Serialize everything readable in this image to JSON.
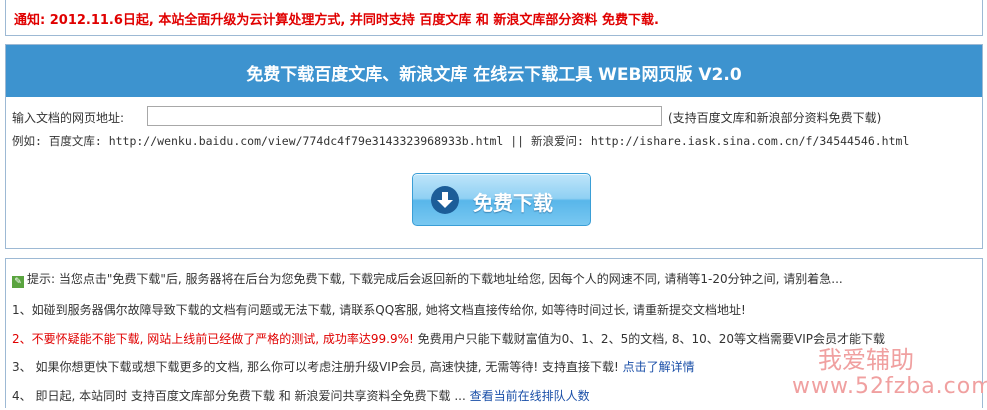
{
  "notice": {
    "text": "通知: 2012.11.6日起, 本站全面升级为云计算处理方式, 并同时支持 百度文库 和 新浪文库部分资料 免费下载."
  },
  "tool": {
    "title": "免费下载百度文库、新浪文库 在线云下载工具 WEB网页版 V2.0",
    "url_label": "输入文档的网页地址:",
    "url_value": "",
    "url_hint": "(支持百度文库和新浪部分资料免费下载)",
    "example": "例如: 百度文库: http://wenku.baidu.com/view/774dc4f79e3143323968933b.html || 新浪爱问: http://ishare.iask.sina.com.cn/f/34544546.html",
    "download_button": "免费下载"
  },
  "info": {
    "tip_icon": "bookmark-icon",
    "tip_text": "提示: 当您点击\"免费下载\"后, 服务器将在后台为您免费下载, 下载完成后会返回新的下载地址给您, 因每个人的网速不同, 请稍等1-20分钟之间, 请别着急...",
    "item1": "1、如碰到服务器偶尔故障导致下载的文档有问题或无法下载, 请联系QQ客服, 她将文档直接传给你, 如等待时间过长, 请重新提交文档地址!",
    "item2_prefix": "2、",
    "item2_red": "不要怀疑能不能下载, 网站上线前已经做了严格的测试, 成功率达99.9%!",
    "item2_rest": " 免费用户只能下载财富值为0、1、2、5的文档, 8、10、20等文档需要VIP会员才能下载",
    "item3": "3、 如果你想更快下载或想下载更多的文档, 那么你可以考虑注册升级VIP会员, 高速快捷, 无需等待! 支持直接下载!",
    "item3_link": "点击了解详情",
    "item4": "4、 即日起, 本站同时 支持百度文库部分免费下载 和 新浪爱问共享资料全免费下载 ...",
    "item4_link": "查看当前在线排队人数"
  },
  "watermark": {
    "name": "我爱辅助",
    "url": "www.52fzba.com"
  },
  "colors": {
    "title_bar": "#3d93cf",
    "notice_red": "#e00000",
    "link_blue": "#1a4fa8",
    "tip_green": "#5aa43f"
  }
}
